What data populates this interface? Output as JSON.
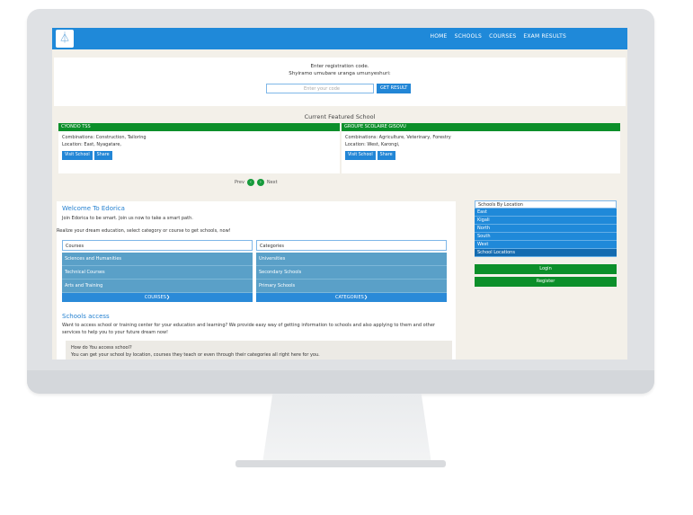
{
  "nav": {
    "logo_glyph": "⏃",
    "links": [
      "HOME",
      "SCHOOLS",
      "COURSES",
      "EXAM RESULTS"
    ]
  },
  "registration": {
    "line1": "Enter registration code.",
    "line2": "Shyiramo umubare uranga umunyeshuri:",
    "input_placeholder": "Enter your code",
    "button": "GET RESULT"
  },
  "featured": {
    "title": "Current Featured School",
    "schools": [
      {
        "name": "CYONDO TSS",
        "combinations": "Combinations: Construction, Tailoring",
        "location": "Location: East, Nyagatare,",
        "visit": "Visit School",
        "share": "Share"
      },
      {
        "name": "GROUPE SCOLAIRE GISOVU",
        "combinations": "Combinations: Agriculture, Veterinary, Forestry",
        "location": "Location: West, Karongi,",
        "visit": "Visit School",
        "share": "Share"
      }
    ],
    "prev": "Prev",
    "next": "Next",
    "prev_icon": "‹",
    "next_icon": "›"
  },
  "welcome": {
    "title": "Welcome To Edorica",
    "text": "Join Edorica to be smart. Join us now to take a smart path.",
    "realize": "Realize your dream education, select category or course to get schools, now!",
    "courses_label": "Courses",
    "categories_label": "Categories",
    "courses": [
      "Sciences and Humanities",
      "Technical Courses",
      "Arts and Training"
    ],
    "courses_footer": "COURSES❯",
    "categories": [
      "Universities",
      "Secondary Schools",
      "Primary Schools"
    ],
    "categories_footer": "CATEGORIES❯",
    "access_title": "Schools access",
    "access_text": "Want to access school or training center for your education and learning? We provide easy way of getting information to schools and also applying to them and other services to help you to your future dream now!",
    "how_question": "How do You access school?",
    "how_answer": "You can get your school by location, courses they teach or even through their categories all right here for you."
  },
  "locations": {
    "title": "Schools By Location",
    "items": [
      "East",
      "Kigali",
      "North",
      "South",
      "West"
    ],
    "school_locations": "School Locations",
    "login": "Login",
    "register": "Register"
  }
}
